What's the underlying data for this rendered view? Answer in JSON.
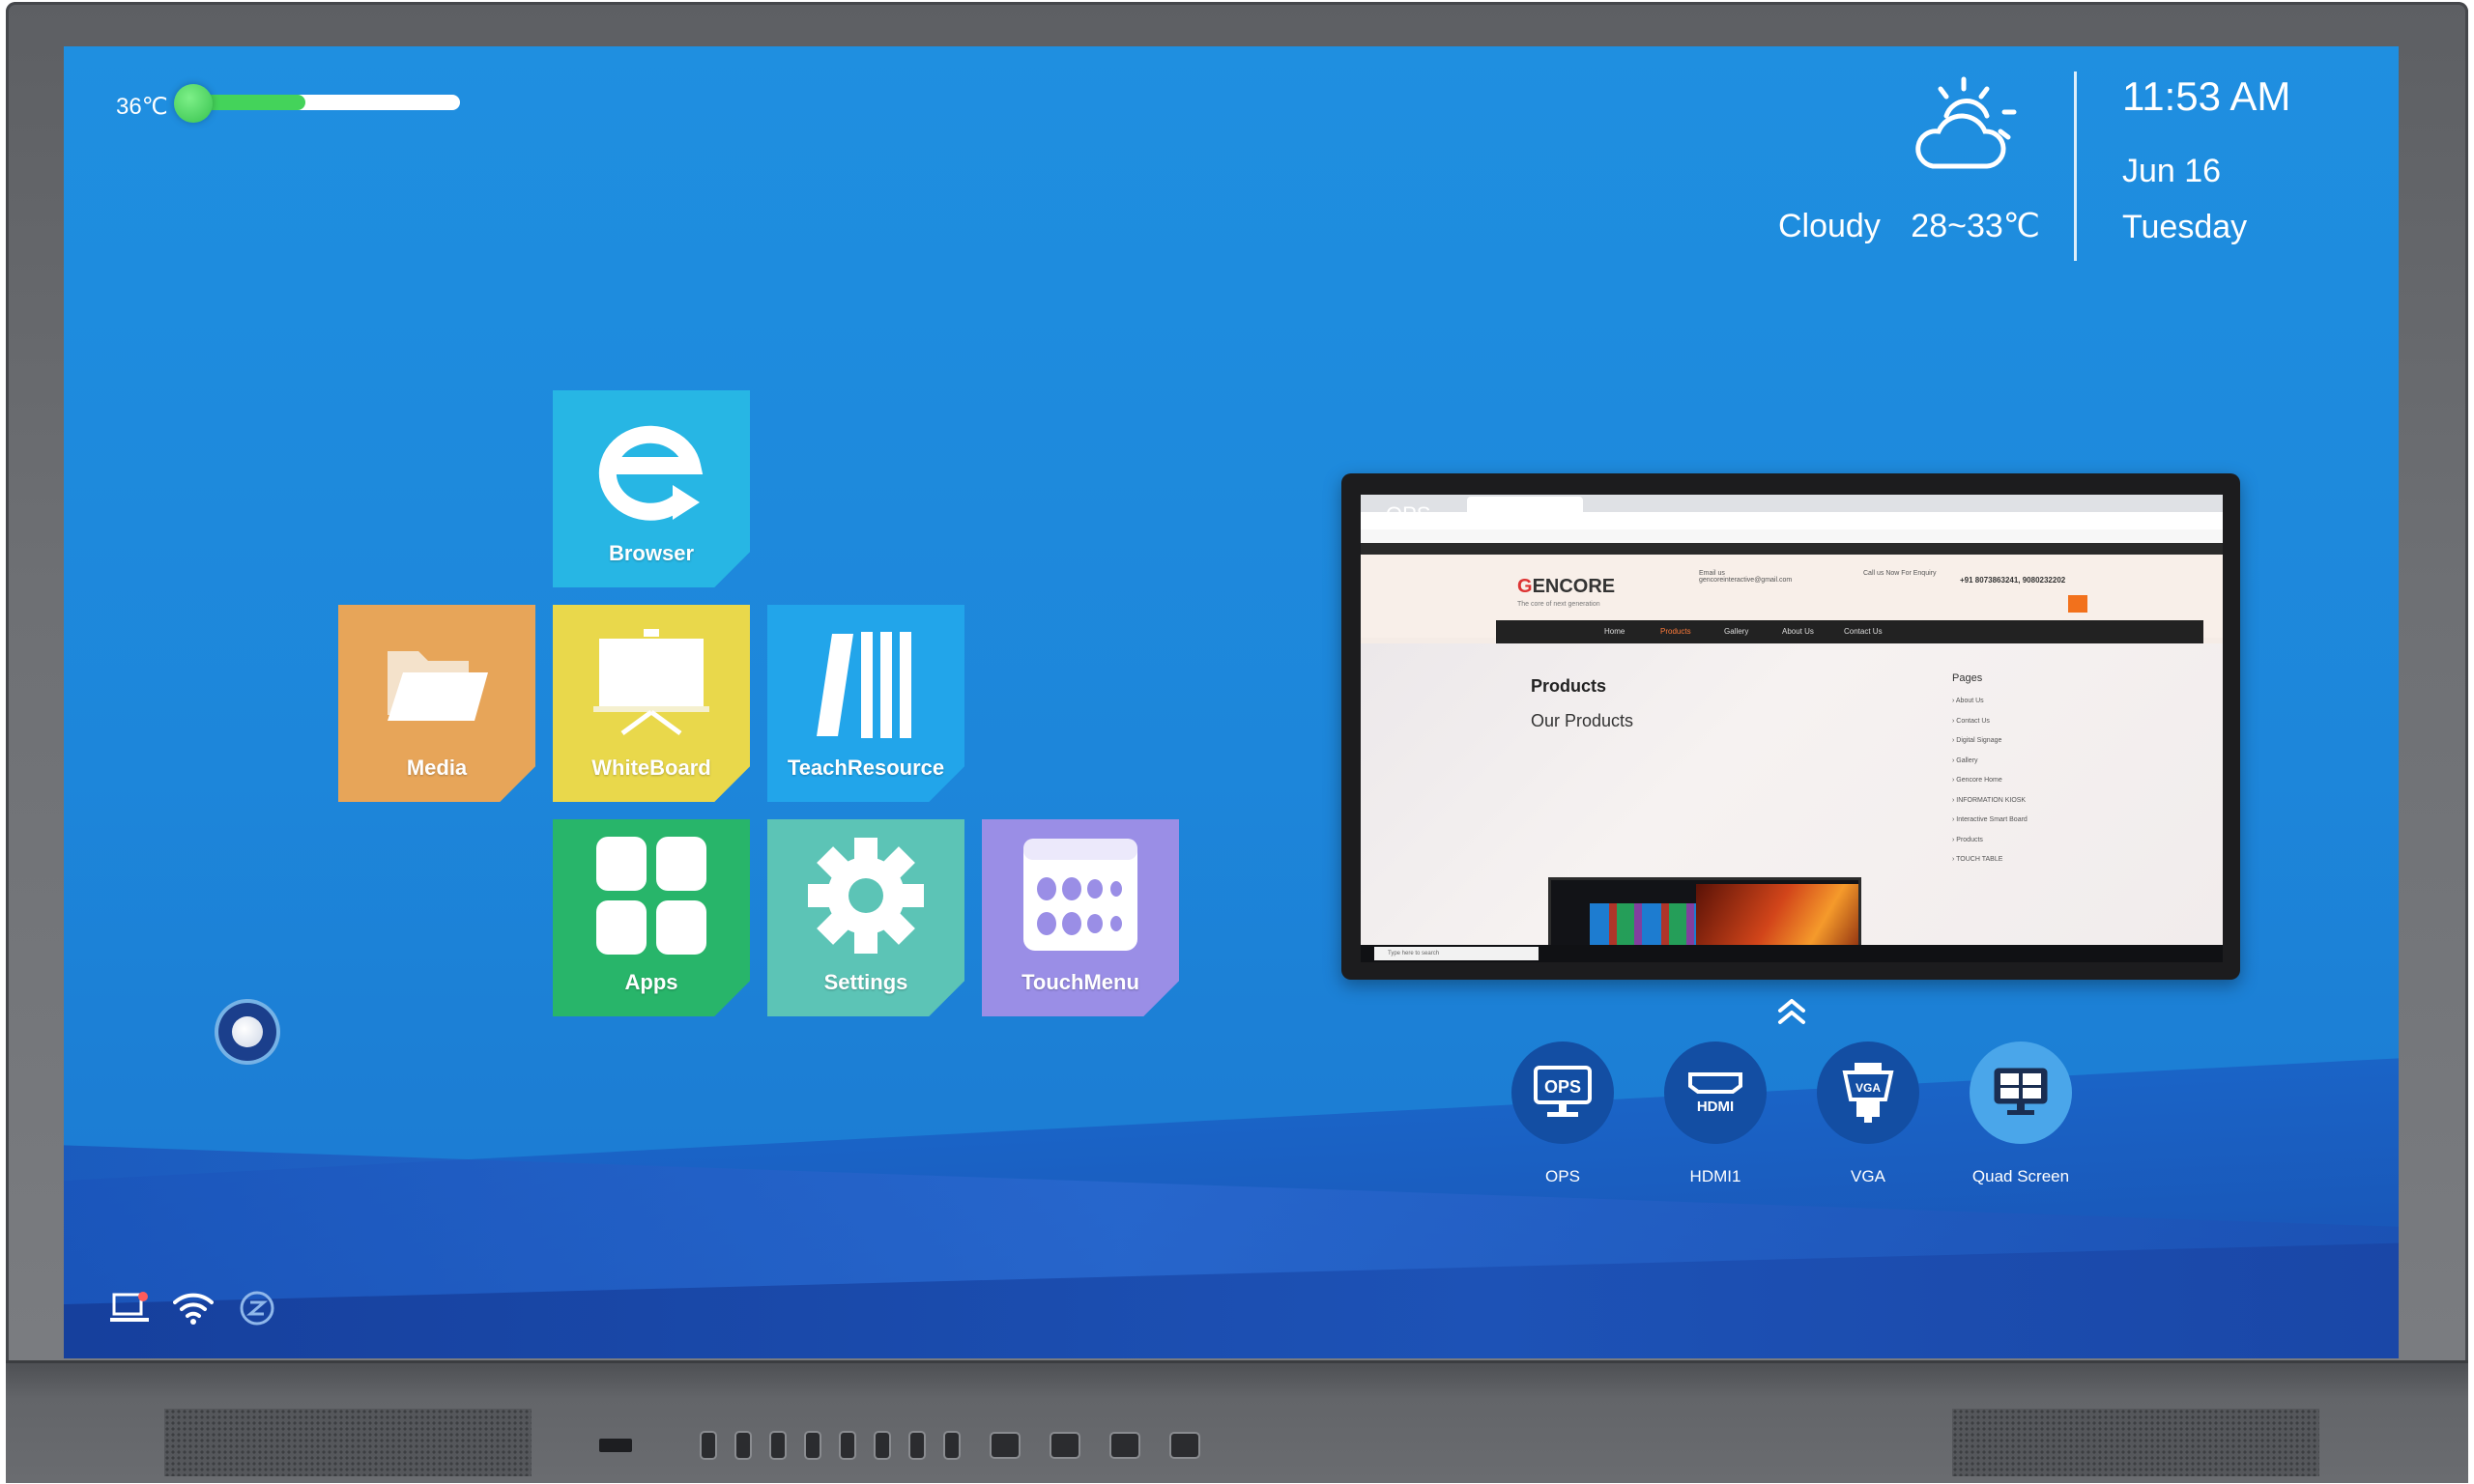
{
  "status_bar": {
    "temperature": "36℃",
    "temperature_level": 0.42
  },
  "weather": {
    "condition": "Cloudy",
    "range": "28~33℃",
    "icon": "partly-cloudy-icon"
  },
  "clock": {
    "time": "11:53 AM",
    "date": "Jun 16",
    "day": "Tuesday"
  },
  "tiles": [
    {
      "label": "Browser",
      "icon": "browser-e-icon",
      "color": "#27b6e4"
    },
    {
      "label": "Media",
      "icon": "folder-icon",
      "color": "#e7a559"
    },
    {
      "label": "WhiteBoard",
      "icon": "easel-board-icon",
      "color": "#e9d84b"
    },
    {
      "label": "TeachResource",
      "icon": "books-icon",
      "color": "#22a5ea"
    },
    {
      "label": "Apps",
      "icon": "grid-icon",
      "color": "#28b56a"
    },
    {
      "label": "Settings",
      "icon": "gear-icon",
      "color": "#5cc4b6"
    },
    {
      "label": "TouchMenu",
      "icon": "menu-dots-icon",
      "color": "#9a8ee6"
    }
  ],
  "preview": {
    "label": "OPS",
    "website": {
      "logo": "ENCORE",
      "tagline": "The core of next generation",
      "email_label": "Email us",
      "email": "gencoreinteractive@gmail.com",
      "call_label": "Call us Now For Enquiry",
      "phone": "+91 8073863241, 9080232202",
      "nav": [
        "Home",
        "Products",
        "Gallery",
        "About Us",
        "Contact Us"
      ],
      "heading": "Products",
      "subheading": "Our Products",
      "pages_title": "Pages",
      "pages": [
        "About Us",
        "Contact Us",
        "Digital Signage",
        "Gallery",
        "Gencore Home",
        "INFORMATION KIOSK",
        "Interactive Smart Board",
        "Products",
        "TOUCH TABLE"
      ],
      "taskbar_search": "Type here to search"
    }
  },
  "sources": [
    {
      "label": "OPS",
      "icon": "ops-monitor-icon",
      "active": false
    },
    {
      "label": "HDMI1",
      "icon": "hdmi-port-icon",
      "active": false
    },
    {
      "label": "VGA",
      "icon": "vga-port-icon",
      "active": false
    },
    {
      "label": "Quad Screen",
      "icon": "quad-screen-icon",
      "active": true
    }
  ],
  "status_icons": [
    "screen-share-icon",
    "wifi-icon",
    "eshare-icon"
  ],
  "colors": {
    "screen_background": "#1f8fe0",
    "source_circle": "#134ea3",
    "source_active": "#4aa6ea",
    "temperature_fill": "#44d35a"
  }
}
